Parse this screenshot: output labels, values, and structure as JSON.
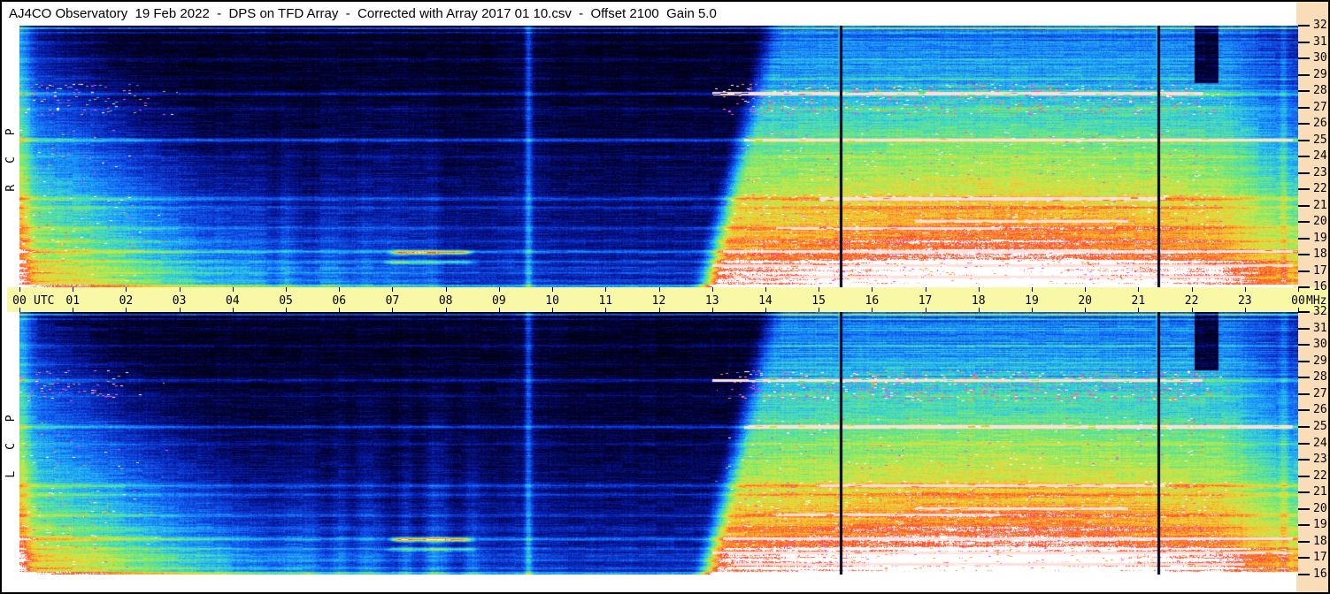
{
  "title": "AJ4CO Observatory  19 Feb 2022  -  DPS on TFD Array  -  Corrected with Array 2017 01 10.csv  -  Offset 2100  Gain 5.0",
  "colors": {
    "title_bg": "#ffffff",
    "page_bg": "#ffffff",
    "border": "#000000",
    "freq_scale_bg": "#f9dcb8",
    "time_strip_bg": "#f8f8a6",
    "axis_text": "#000000"
  },
  "panels": [
    {
      "id": "rcp",
      "label": "R C P",
      "polarization": "Right Circular Polarization",
      "seed": 7
    },
    {
      "id": "lcp",
      "label": "L C P",
      "polarization": "Left Circular Polarization",
      "seed": 13
    }
  ],
  "time_axis": {
    "hours": [
      "00",
      "01",
      "02",
      "03",
      "04",
      "05",
      "06",
      "07",
      "08",
      "09",
      "10",
      "11",
      "12",
      "13",
      "14",
      "15",
      "16",
      "17",
      "18",
      "19",
      "20",
      "21",
      "22",
      "23",
      "00"
    ],
    "unit_after_first": "UTC",
    "unit_after_last": "MHz"
  },
  "freq_axis": {
    "ticks": [
      32,
      31,
      30,
      29,
      28,
      27,
      26,
      25,
      24,
      23,
      22,
      21,
      20,
      19,
      18,
      17,
      16
    ],
    "unit": "MHz"
  },
  "chart_data": {
    "type": "heatmap",
    "title": "AJ4CO Observatory dynamic power spectrum (DPS) on TFD Array, 19 Feb 2022",
    "xlabel": "Time (UTC)",
    "ylabel": "Frequency (MHz)",
    "x_range": [
      0,
      24
    ],
    "y_range": [
      16,
      32
    ],
    "panels": [
      "RCP (top)",
      "LCP (bottom)"
    ],
    "colormap": "black -> blue -> cyan -> green -> yellow -> orange/red with increasing power; magenta/white = strongest RFI",
    "features": [
      "Bright background 00:00-02:30 UTC below ~24 MHz fading diagonally (persists longer at lower frequencies)",
      "Quiet dark period ~03:00-12:30 UTC with faint blue vertical static bands 04:00-08:30 at lower frequencies (stronger in LCP)",
      "Narrow bright vertical flash near 09:33 UTC spanning all frequencies",
      "Daytime ionospheric brightening starting ~12:40 UTC at low frequencies, ~13:50 at high, lasting to ~23:00 UTC",
      "Intense RFI streak band (magenta/orange/white) 26.5-28.5 MHz during daytime",
      "Broad yellow/green enhancement 16-22 MHz ~14:00-22:00 UTC crossed by white carrier lines",
      "Persistent horizontal RFI carriers near 31.0, 29.9, 27.8, 25.0, 21.4, 19.6, 18.1, 17.5, 16.8 MHz",
      "Vertical data-gap lines at ~15:25 and ~21:22 UTC in both panels",
      "Dark dropout patch 22:00-22:30 UTC above ~28.5 MHz",
      "Bright narrowband streak near 18.1 MHz at 07:00-08:30 UTC",
      "Two bright blue carrier rows at the very top (~32 MHz) across the whole day"
    ]
  },
  "render": {
    "dawn": {
      "t0": 12.55,
      "slope": 1.25,
      "soft": 0.6
    },
    "flash_t": 9.55,
    "late_line_t": 23.72,
    "gap_t": [
      15.41,
      21.37
    ],
    "dark_patch": {
      "t0": 22.05,
      "t1": 22.5,
      "fn": 0.78
    },
    "vband": {
      "t0": 3.6,
      "t1": 9.0,
      "amp": [
        0.13,
        0.2
      ]
    },
    "rfi_lines": [
      [
        31.0,
        0.07
      ],
      [
        29.95,
        0.09
      ],
      [
        28.8,
        0.05
      ],
      [
        27.85,
        0.16
      ],
      [
        26.9,
        0.07
      ],
      [
        25.0,
        0.22
      ],
      [
        23.95,
        0.06
      ],
      [
        21.4,
        0.16
      ],
      [
        20.85,
        0.1
      ],
      [
        19.6,
        0.12
      ],
      [
        18.8,
        0.06
      ],
      [
        18.15,
        0.2
      ],
      [
        17.55,
        0.12
      ],
      [
        17.15,
        0.1
      ],
      [
        16.85,
        0.1
      ],
      [
        16.35,
        0.09
      ]
    ],
    "white_segments": [
      [
        25.0,
        13.6,
        23.9
      ],
      [
        21.4,
        15.0,
        21.5
      ],
      [
        19.6,
        14.2,
        18.4
      ],
      [
        18.15,
        13.2,
        23.9
      ],
      [
        17.3,
        13.0,
        23.9
      ],
      [
        16.6,
        13.4,
        23.0
      ],
      [
        20.0,
        16.8,
        20.8
      ],
      [
        27.85,
        13.0,
        22.2
      ]
    ],
    "night_streaks": [
      [
        18.1,
        7.0,
        8.45,
        0.55
      ],
      [
        17.5,
        6.9,
        8.5,
        0.25
      ]
    ],
    "streak_bands": [
      {
        "f0": 26.55,
        "f1": 28.45,
        "density": 1.0,
        "magenta": 0.4,
        "white": 0.25,
        "orange": 0.25
      },
      {
        "f0": 16.3,
        "f1": 21.7,
        "density": 0.5,
        "magenta": 0.15,
        "white": 0.3,
        "orange": 0.4
      },
      {
        "f0": 22.4,
        "f1": 25.6,
        "density": 0.18,
        "magenta": 0.25,
        "white": 0.4,
        "orange": 0.2
      }
    ]
  }
}
